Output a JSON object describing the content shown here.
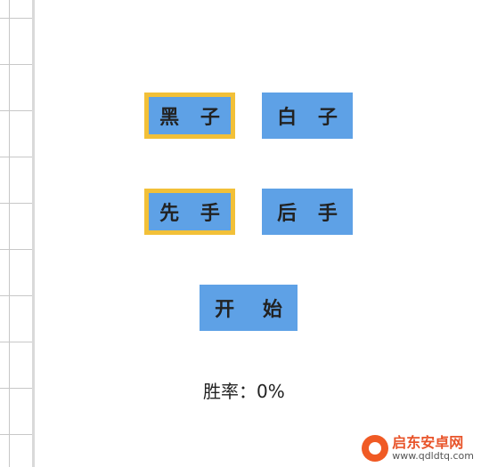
{
  "options": {
    "color_black": "黑 子",
    "color_white": "白 子",
    "order_first": "先 手",
    "order_second": "后 手",
    "start": "开 始"
  },
  "selected": {
    "color": "black",
    "order": "first"
  },
  "stats": {
    "win_rate": "胜率：0%"
  },
  "watermark": {
    "title": "启东安卓网",
    "url": "www.qdldtq.com"
  },
  "colors": {
    "button_bg": "#5ea1e6",
    "selected_border": "#f2c038",
    "text": "#222222"
  }
}
